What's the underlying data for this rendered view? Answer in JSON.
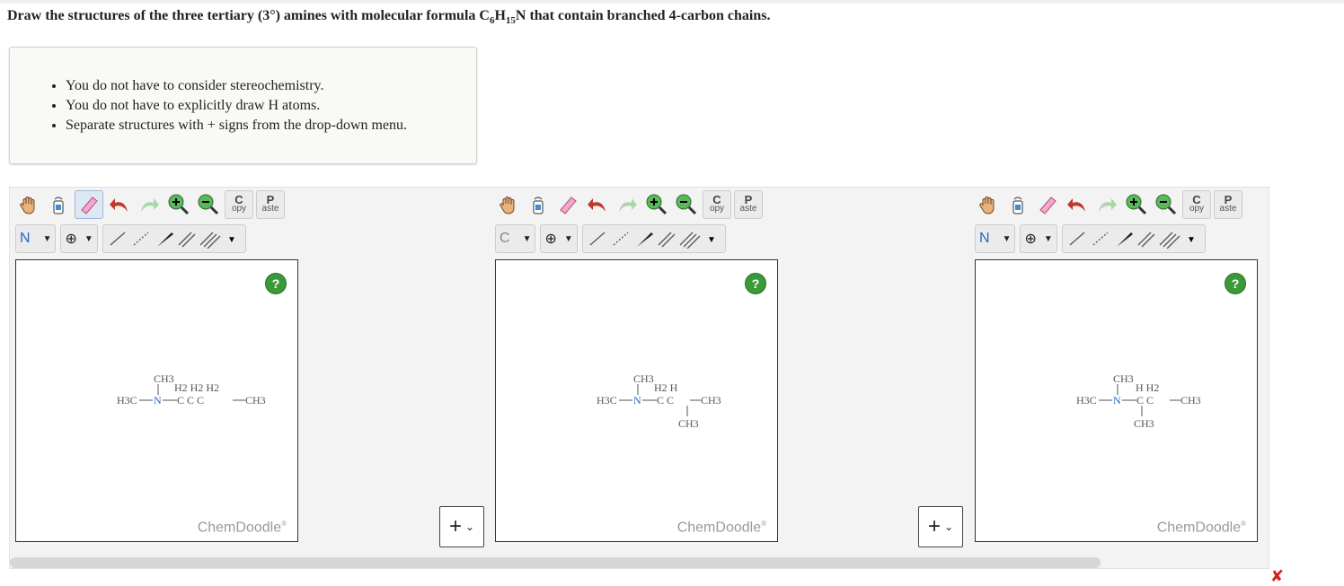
{
  "question": {
    "prefix": "Draw the structures of the three tertiary (3°) amines with molecular formula C",
    "sub1": "6",
    "mid": "H",
    "sub2": "15",
    "suffix": "N that contain branched 4-carbon chains."
  },
  "hints": [
    "You do not have to consider stereochemistry.",
    "You do not have to explicitly draw H atoms.",
    "Separate structures with + signs from the drop-down menu."
  ],
  "sketchers": [
    {
      "element": "N",
      "element_color": "#2266cc",
      "help": "?",
      "brand": "ChemDoodle",
      "molecule": {
        "top": "CH3",
        "hrow": "H2  H2  H2",
        "main_left": "H3C",
        "n": "N",
        "chain": "C  C  C",
        "main_right": "CH3",
        "bottom": ""
      }
    },
    {
      "element": "C",
      "element_color": "#888888",
      "help": "?",
      "brand": "ChemDoodle",
      "molecule": {
        "top": "CH3",
        "hrow": "H2  H",
        "main_left": "H3C",
        "n": "N",
        "chain": "C  C",
        "main_right": "CH3",
        "bottom": "CH3"
      }
    },
    {
      "element": "N",
      "element_color": "#2266cc",
      "help": "?",
      "brand": "ChemDoodle",
      "molecule": {
        "top": "CH3",
        "hrow": "H  H2",
        "main_left": "H3C",
        "n": "N",
        "chain": "C  C",
        "main_right": "CH3",
        "bottom": "CH3"
      }
    }
  ],
  "toolbar": {
    "copy_top": "C",
    "copy_bottom": "opy",
    "paste_top": "P",
    "paste_bottom": "aste",
    "charge": "[ ]±"
  },
  "plus_button": "+",
  "status_icon": "error-x",
  "colors": {
    "accent_blue": "#2266cc",
    "help_green": "#3a9a3a",
    "error_red": "#d42020"
  }
}
